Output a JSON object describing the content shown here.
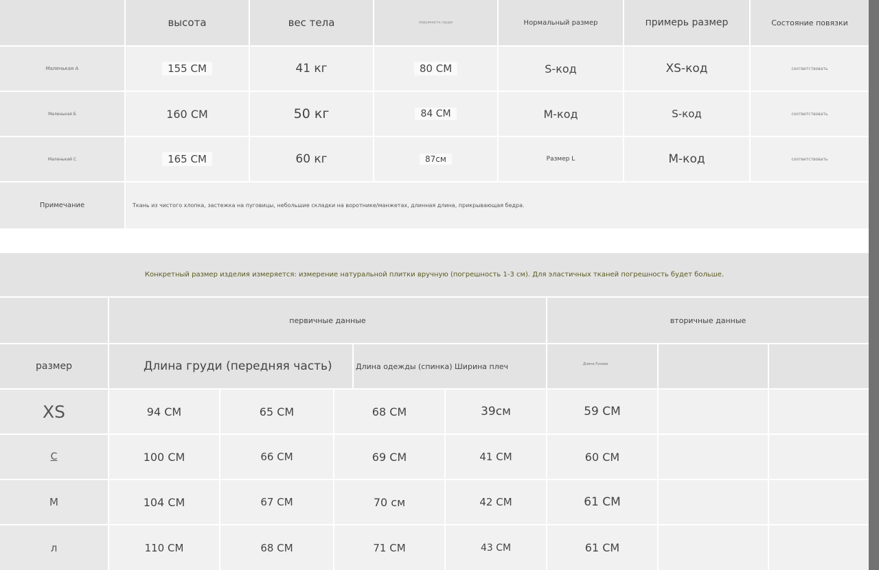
{
  "table1": {
    "headers": [
      "высота",
      "вес тела",
      "окружность груди",
      "Нормальный размер",
      "примерь размер",
      "Состояние повязки"
    ],
    "rows": [
      {
        "label": "Маленькая A",
        "values": [
          "155 СМ",
          "41 кг",
          "80 СМ",
          "S-код",
          "XS-код",
          "соответствовать"
        ]
      },
      {
        "label": "Маленькая Б",
        "values": [
          "160 СМ",
          "50 кг",
          "84 СМ",
          "M-код",
          "S-код",
          "соответствовать"
        ]
      },
      {
        "label": "Маленький С",
        "values": [
          "165 СМ",
          "60 кг",
          "87см",
          "Размер L",
          "M-код",
          "соответствовать"
        ]
      }
    ],
    "note_label": "Примечание",
    "note_text": "Ткань из чистого хлопка, застежка на пуговицы, небольшие складки на воротнике/манжетах, длинная длина, прикрывающая бедра."
  },
  "measure_note": "Конкретный размер изделия измеряется: измерение натуральной плитки вручную (погрешность 1-3 см). Для эластичных тканей погрешность будет больше.",
  "table2": {
    "group_primary": "первичные данные",
    "group_secondary": "вторичные данные",
    "size_label": "размер",
    "col_chest": "Длина груди (передняя часть)",
    "col_length": "Длина одежды (спинка) Ширина плеч",
    "col_sleeve": "Длина Рукава",
    "rows": [
      {
        "size": "XS",
        "values": [
          "94 СМ",
          "65 СМ",
          "68 СМ",
          "39см",
          "59 СМ"
        ]
      },
      {
        "size": "С",
        "values": [
          "100 СМ",
          "66 СМ",
          "69 СМ",
          "41 СМ",
          "60 СМ"
        ]
      },
      {
        "size": "M",
        "values": [
          "104 СМ",
          "67 СМ",
          "70 см",
          "42 СМ",
          "61 СМ"
        ]
      },
      {
        "size": "л",
        "values": [
          "110 СМ",
          "68 СМ",
          "71 СМ",
          "43 СМ",
          "61 СМ"
        ]
      }
    ]
  }
}
